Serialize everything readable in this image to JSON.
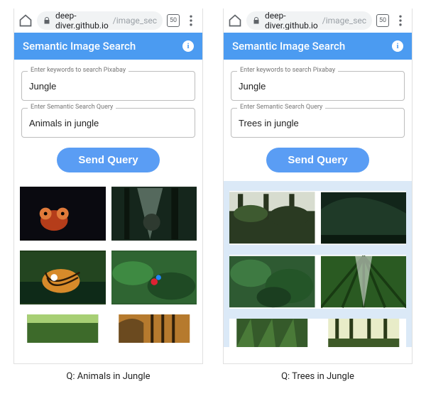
{
  "browser": {
    "url_main": "deep-diver.github.io",
    "url_rest": "/image_sec",
    "tab_count": "50"
  },
  "app": {
    "title": "Semantic Image Search",
    "info_glyph": "i",
    "keywords_field_label": "Enter keywords to search Pixabay",
    "semantic_field_label": "Enter Semantic Search Query",
    "send_label": "Send Query"
  },
  "left": {
    "keywords_value": "Jungle",
    "semantic_value": "Animals in jungle",
    "caption": "Q: Animals in Jungle"
  },
  "right": {
    "keywords_value": "Jungle",
    "semantic_value": "Trees in jungle",
    "caption": "Q: Trees in Jungle"
  }
}
